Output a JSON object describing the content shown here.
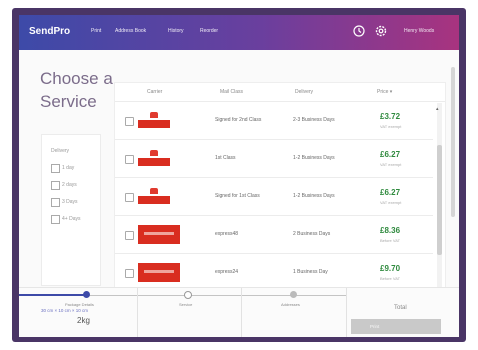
{
  "topbar": {
    "brand": "SendPro",
    "nav": [
      "Print",
      "Address Book",
      "History",
      "Reorder"
    ],
    "user": "Henry Woods",
    "icons": [
      "clock-icon",
      "gear-icon"
    ]
  },
  "page": {
    "title_line1": "Choose a",
    "title_line2": "Service"
  },
  "filter": {
    "title": "Delivery",
    "options": [
      "1 day",
      "2 days",
      "3 Days",
      "4+ Days"
    ]
  },
  "table": {
    "headers": [
      "Carrier",
      "Mail Class",
      "Delivery",
      "Price ▾"
    ],
    "rows": [
      {
        "logo": "royal-mail-small",
        "mail_class": "Signed for 2nd Class",
        "delivery": "2-3 Business Days",
        "price": "£3.72",
        "vat": "VAT exempt"
      },
      {
        "logo": "royal-mail-small",
        "mail_class": "1st Class",
        "delivery": "1-2 Business Days",
        "price": "£6.27",
        "vat": "VAT exempt"
      },
      {
        "logo": "royal-mail-small",
        "mail_class": "Signed for 1st Class",
        "delivery": "1-2 Business Days",
        "price": "£6.27",
        "vat": "VAT exempt"
      },
      {
        "logo": "parcelforce",
        "mail_class": "express48",
        "delivery": "2 Business Days",
        "price": "£8.36",
        "vat": "Before VAT"
      },
      {
        "logo": "parcelforce",
        "mail_class": "express24",
        "delivery": "1 Business Day",
        "price": "£9.70",
        "vat": "Before VAT"
      }
    ]
  },
  "footer": {
    "steps": [
      "Package Details",
      "Service",
      "Addresses"
    ],
    "package_size": "30 cm × 10 cm × 10 cm",
    "package_weight": "2kg",
    "total_label": "Total",
    "print_label": "Print",
    "progress_step": 1
  },
  "colors": {
    "brand_gradient": [
      "#3d4aa8",
      "#6a3f9e",
      "#a8337f"
    ],
    "price": "#2f8a3e",
    "royal_mail_red": "#d92d20"
  }
}
